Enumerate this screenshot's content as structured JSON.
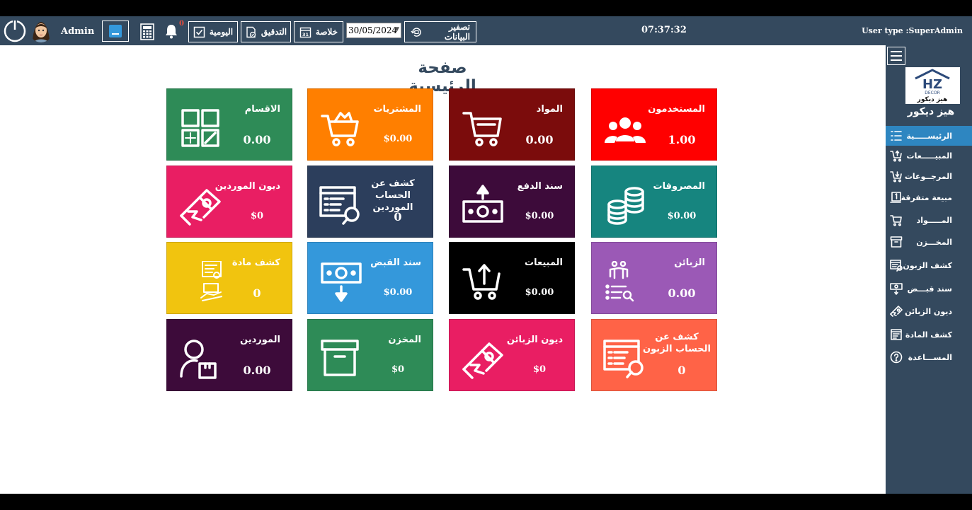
{
  "header": {
    "admin_name": "Admin",
    "notification_count": "0",
    "buttons": {
      "daily": "اليومية",
      "audit": "التدقيق",
      "summary": "خلاصة",
      "reset_data": "تصفير البيانات"
    },
    "date_value": "30/05/2024",
    "clock": "07:37:32",
    "user_type": "User type :SuperAdmin"
  },
  "page_title": "صفحة الرئيسية",
  "tiles": [
    {
      "label": "المستخدمون",
      "value": "1.00",
      "color": "#ff0000",
      "icon": "users-icon"
    },
    {
      "label": "المواد",
      "value": "0.00",
      "color": "#7b0c0c",
      "icon": "cart-icon"
    },
    {
      "label": "المشتريات",
      "value": "$0.00",
      "color": "#ff7f00",
      "icon": "basket-icon"
    },
    {
      "label": "الاقسام",
      "value": "0.00",
      "color": "#2e8b57",
      "icon": "grid-icon"
    },
    {
      "label": "المصروفات",
      "value": "$0.00",
      "color": "#16857f",
      "icon": "coins-icon"
    },
    {
      "label": "سند الدفع",
      "value": "$0.00",
      "color": "#3d0b3a",
      "icon": "cash-up-icon"
    },
    {
      "label": "كشف عن الحساب الموردين",
      "value": "0",
      "color": "#2c3e5c",
      "icon": "statement-search-icon"
    },
    {
      "label": "ديون الموردين",
      "value": "$0",
      "color": "#e91e63",
      "icon": "hand-money-icon"
    },
    {
      "label": "الزبائن",
      "value": "0.00",
      "color": "#9b59b6",
      "icon": "customers-icon"
    },
    {
      "label": "المبيعات",
      "value": "$0.00",
      "color": "#000000",
      "icon": "cart-up-icon"
    },
    {
      "label": "سند القبض",
      "value": "$0.00",
      "color": "#3498db",
      "icon": "cash-down-icon"
    },
    {
      "label": "كشف مادة",
      "value": "0",
      "color": "#f1c40f",
      "icon": "item-statement-icon"
    },
    {
      "label": "كشف عن الحساب الزبون",
      "value": "0",
      "color": "#ff6347",
      "icon": "statement-search-icon"
    },
    {
      "label": "ديون الزبائن",
      "value": "$0",
      "color": "#e91e63",
      "icon": "hand-money-icon"
    },
    {
      "label": "المخزن",
      "value": "$0",
      "color": "#2e8b57",
      "icon": "archive-icon"
    },
    {
      "label": "الموردين",
      "value": "0.00",
      "color": "#3d0b3a",
      "icon": "supplier-icon"
    }
  ],
  "sidebar": {
    "logo_text": "هيز ديكور",
    "logo_brand": "HZ DECOR هيز ديكور",
    "items": [
      {
        "label": "الرئيســـــية",
        "icon": "list-icon"
      },
      {
        "label": "المبيـــــعات",
        "icon": "cart-up-icon"
      },
      {
        "label": "المرجــوعات",
        "icon": "cart-return-icon"
      },
      {
        "label": "مبيعة متفرقة",
        "icon": "single-sale-icon"
      },
      {
        "label": "المـــــواد",
        "icon": "cart-icon"
      },
      {
        "label": "المخـــزن",
        "icon": "archive-icon"
      },
      {
        "label": "كشف الزبون",
        "icon": "statement-search-icon"
      },
      {
        "label": "سند قبـــض",
        "icon": "cash-down-icon"
      },
      {
        "label": "ديون الزبائن",
        "icon": "hand-money-icon"
      },
      {
        "label": "كشف المادة",
        "icon": "item-statement-icon"
      },
      {
        "label": "المســـاعدة",
        "icon": "help-icon"
      }
    ]
  }
}
